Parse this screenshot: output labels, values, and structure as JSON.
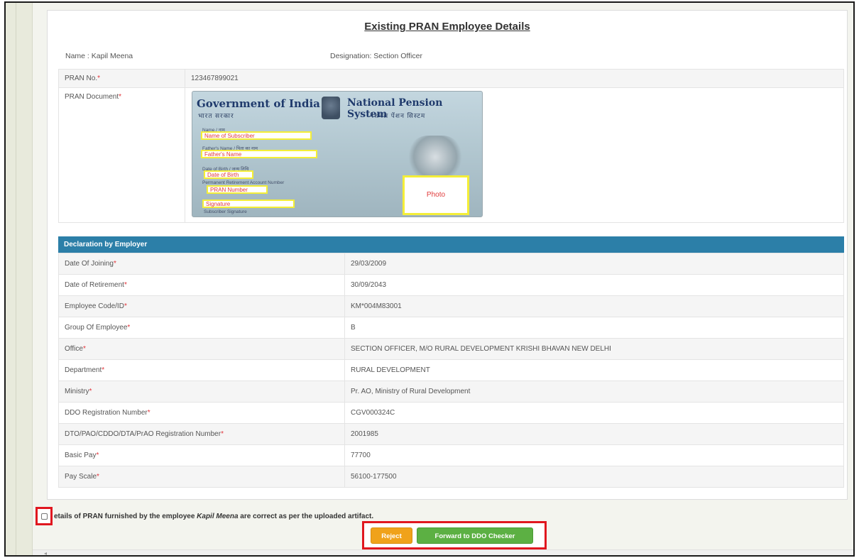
{
  "page": {
    "title": "Existing PRAN Employee Details",
    "name_label": "Name : Kapil Meena",
    "designation_label": "Designation: Section Officer"
  },
  "pran": {
    "number_label": "PRAN No.",
    "number_value": "123467899021",
    "document_label": "PRAN Document",
    "card": {
      "left_title": "Government of India",
      "left_subtitle": "भारत सरकार",
      "right_title": "National Pension System",
      "right_subtitle": "नेशनल पेंशन सिस्टम",
      "name_caption": "Name / नाम",
      "name_field": "Name of Subscriber",
      "father_caption": "Father's Name / पिता का नाम",
      "father_field": "Father's Name",
      "dob_caption": "Date of Birth / जन्म तिथि",
      "dob_field": "Date of Birth",
      "pran_caption": "Permanent Retirement Account Number",
      "pran_field": "PRAN Number",
      "signature_field": "Signature",
      "signature_caption": "Subscriber Signature",
      "photo_label": "Photo"
    }
  },
  "declaration": {
    "header": "Declaration by Employer",
    "rows": [
      {
        "label": "Date Of Joining",
        "value": "29/03/2009"
      },
      {
        "label": "Date of Retirement",
        "value": "30/09/2043"
      },
      {
        "label": "Employee Code/ID",
        "value": "KM*004M83001"
      },
      {
        "label": "Group Of Employee",
        "value": "B"
      },
      {
        "label": "Office",
        "value": "SECTION OFFICER, M/O RURAL DEVELOPMENT KRISHI BHAVAN NEW DELHI"
      },
      {
        "label": "Department",
        "value": "RURAL DEVELOPMENT"
      },
      {
        "label": "Ministry",
        "value": "Pr. AO, Ministry of Rural Development"
      },
      {
        "label": "DDO Registration Number",
        "value": "CGV000324C"
      },
      {
        "label": "DTO/PAO/CDDO/DTA/PrAO Registration Number",
        "value": "2001985"
      },
      {
        "label": "Basic Pay",
        "value": "77700"
      },
      {
        "label": "Pay Scale",
        "value": "56100-177500"
      }
    ]
  },
  "confirm": {
    "text_before": "etails of PRAN furnished by the employee ",
    "employee_name": "Kapil Meena",
    "text_after": " are correct as per the uploaded artifact."
  },
  "buttons": {
    "reject": "Reject",
    "forward": "Forward to DDO Checker"
  },
  "colors": {
    "header_bar": "#2c7fa8",
    "reject": "#f0a21a",
    "forward": "#5cb043",
    "highlight": "#e0171f",
    "required": "#e2343a"
  }
}
